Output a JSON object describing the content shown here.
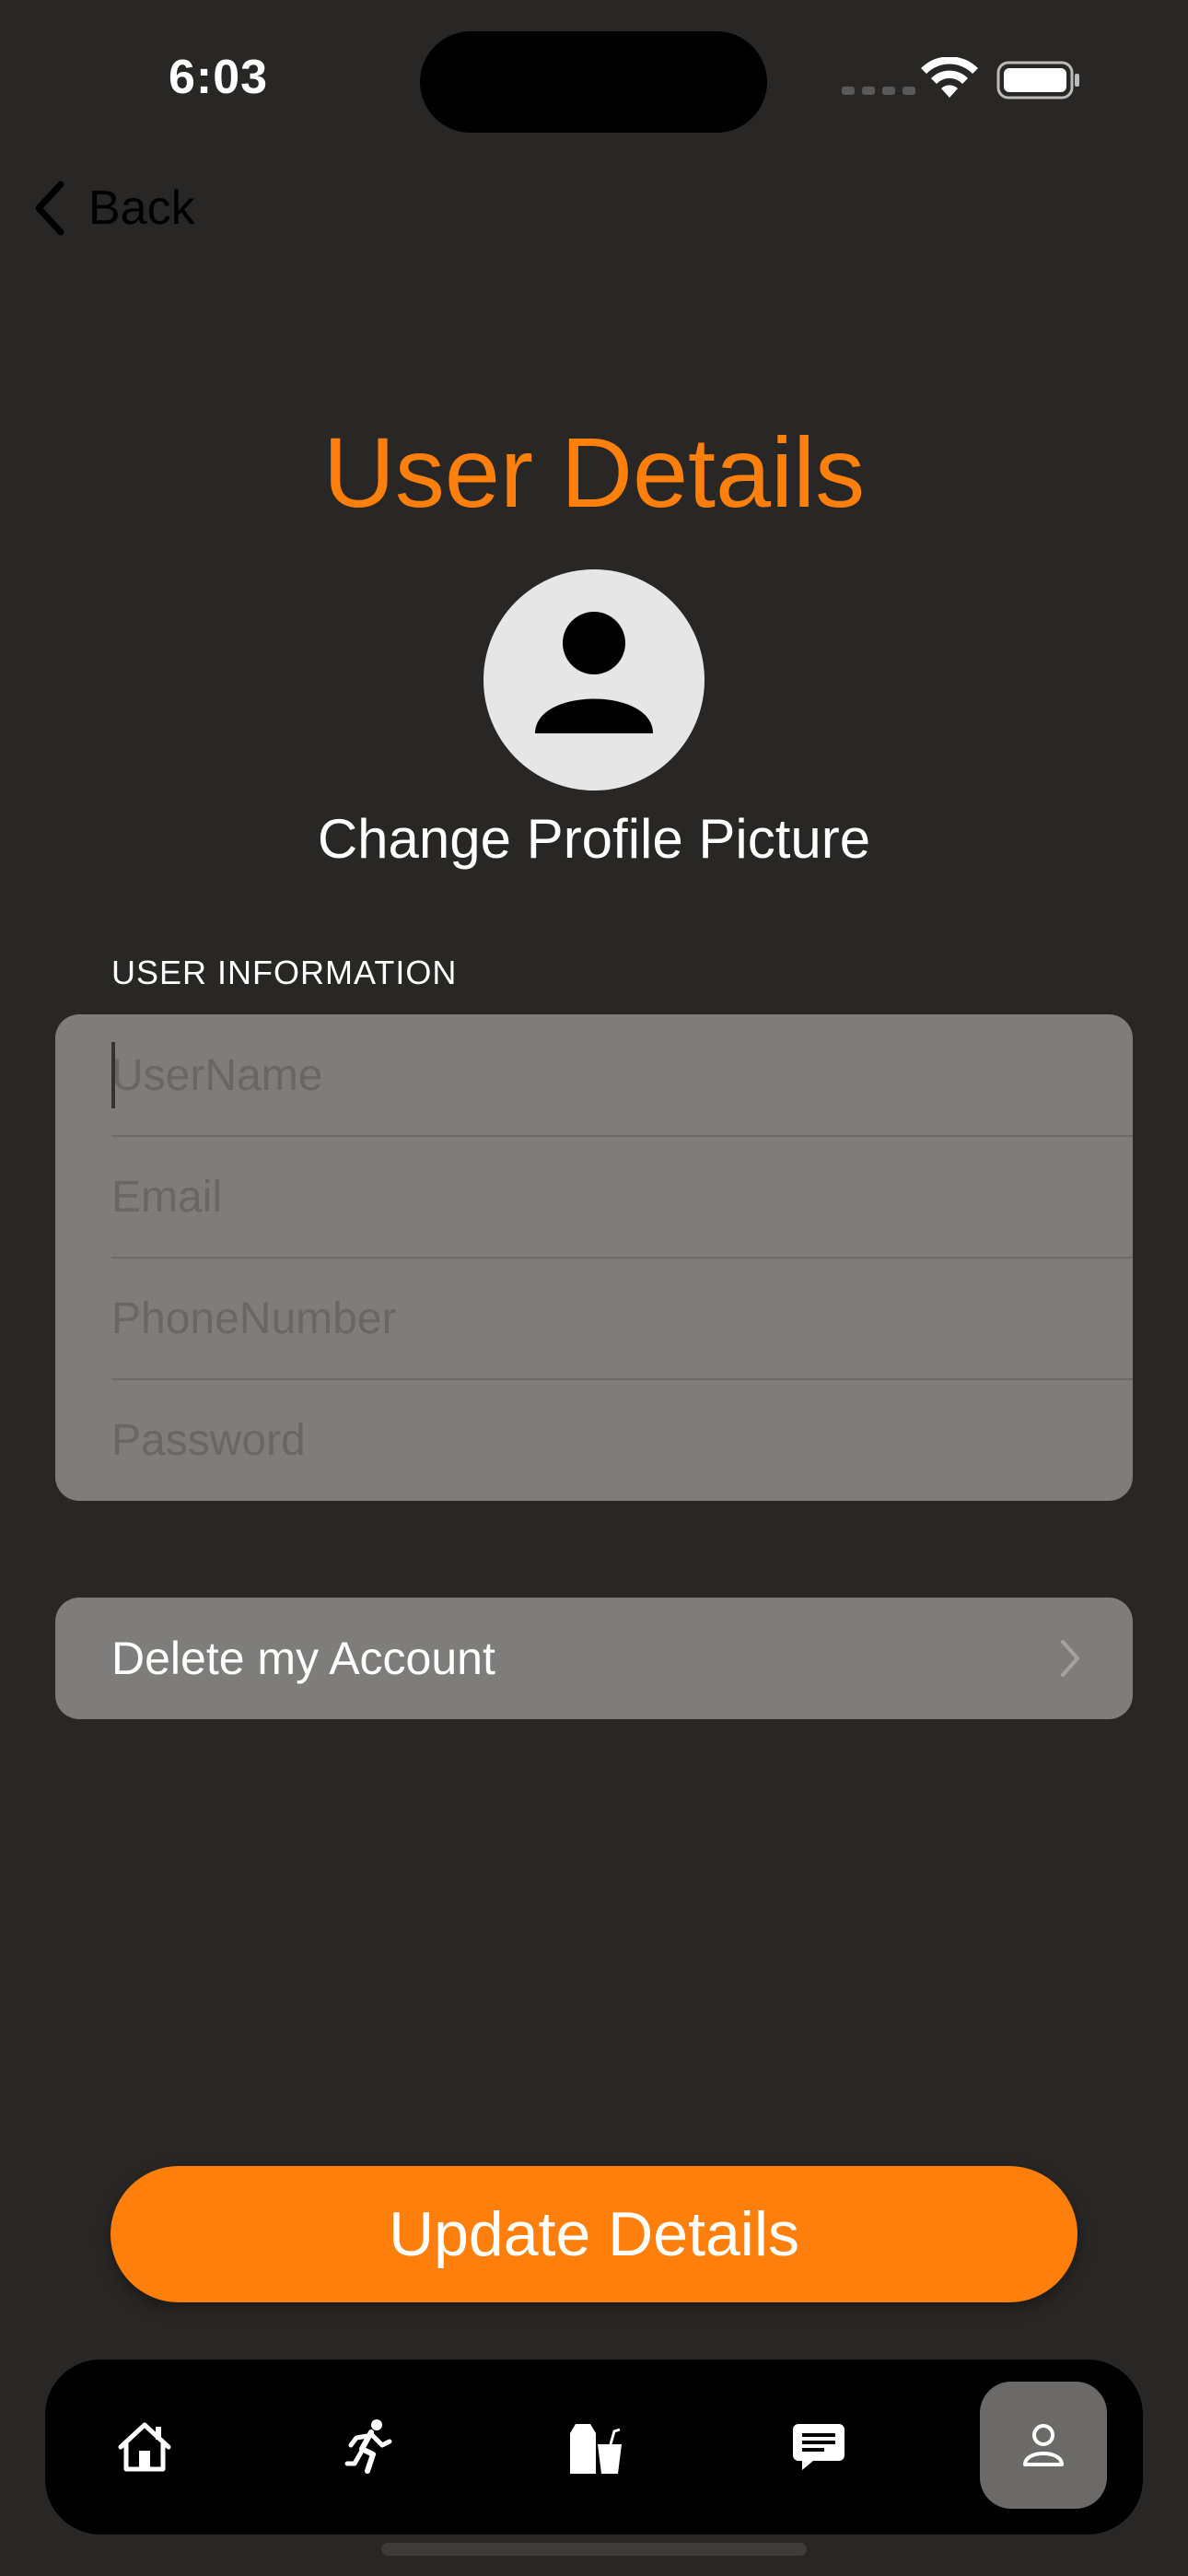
{
  "status_bar": {
    "time": "6:03"
  },
  "nav": {
    "back_label": "Back"
  },
  "page": {
    "title": "User Details",
    "change_picture_label": "Change Profile Picture"
  },
  "form": {
    "section_label": "USER INFORMATION",
    "fields": [
      {
        "placeholder": "UserName",
        "value": ""
      },
      {
        "placeholder": "Email",
        "value": ""
      },
      {
        "placeholder": "PhoneNumber",
        "value": ""
      },
      {
        "placeholder": "Password",
        "value": ""
      }
    ]
  },
  "delete_account": {
    "label": "Delete my Account"
  },
  "update_button": {
    "label": "Update Details"
  },
  "tab_bar": {
    "tabs": [
      {
        "icon": "house-icon",
        "active": false
      },
      {
        "icon": "running-person-icon",
        "active": false
      },
      {
        "icon": "drink-icon",
        "active": false
      },
      {
        "icon": "message-icon",
        "active": false
      },
      {
        "icon": "person-icon",
        "active": true
      }
    ]
  },
  "colors": {
    "accent": "#ff7f0c",
    "background": "#282725",
    "card": "#7e7d7b",
    "tab_bar": "#000000"
  }
}
